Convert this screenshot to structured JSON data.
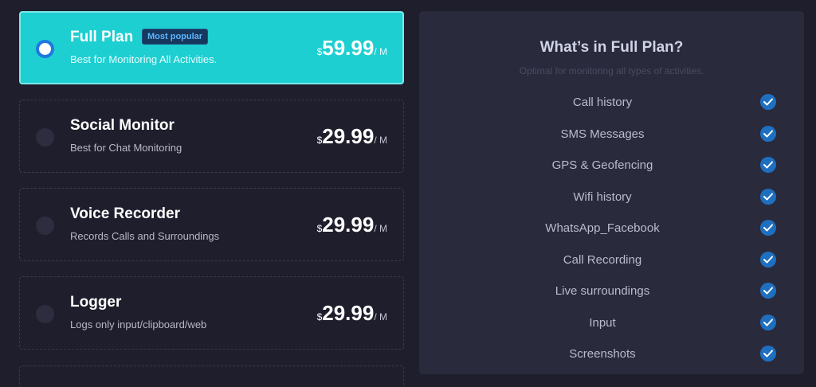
{
  "plans": [
    {
      "name": "Full Plan",
      "badge": "Most popular",
      "description": "Best for Monitoring All Activities.",
      "currency": "$",
      "price": "59.99",
      "period": "/ M",
      "selected": true
    },
    {
      "name": "Social Monitor",
      "description": "Best for Chat Monitoring",
      "currency": "$",
      "price": "29.99",
      "period": "/ M",
      "selected": false
    },
    {
      "name": "Voice Recorder",
      "description": "Records Calls and Surroundings",
      "currency": "$",
      "price": "29.99",
      "period": "/ M",
      "selected": false
    },
    {
      "name": "Logger",
      "description": "Logs only input/clipboard/web",
      "currency": "$",
      "price": "29.99",
      "period": "/ M",
      "selected": false
    }
  ],
  "features_panel": {
    "title": "What’s in Full Plan?",
    "subtitle": "Optimal for monitoring all types of activities.",
    "check_icon": "check-circle-icon",
    "items": [
      "Call history",
      "SMS Messages",
      "GPS & Geofencing",
      "Wifi history",
      "WhatsApp_Facebook",
      "Call Recording",
      "Live surroundings",
      "Input",
      "Screenshots"
    ]
  },
  "colors": {
    "background": "#1f1e2c",
    "selected_card": "#1dcfd1",
    "panel": "#2a2a3d",
    "check": "#1e6fc0",
    "badge_text": "#5cb4ff"
  }
}
